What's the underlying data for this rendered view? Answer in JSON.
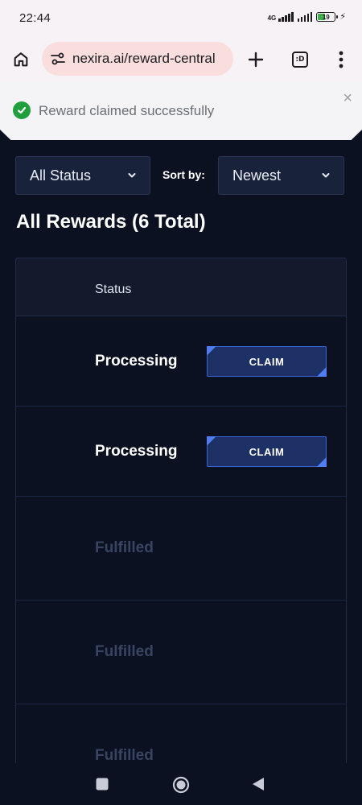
{
  "status_bar": {
    "time": "22:44",
    "network": "4G",
    "battery_level": "19"
  },
  "browser": {
    "url": "nexira.ai/reward-central",
    "tabs_label": ":D"
  },
  "toast": {
    "message": "Reward claimed successfully",
    "close_glyph": "×"
  },
  "filters": {
    "status_value": "All Status",
    "sort_label": "Sort by:",
    "sort_value": "Newest"
  },
  "list": {
    "title": "All Rewards (6 Total)",
    "column_status": "Status",
    "rows": [
      {
        "status": "Processing",
        "action": "CLAIM"
      },
      {
        "status": "Processing",
        "action": "CLAIM"
      },
      {
        "status": "Fulfilled"
      },
      {
        "status": "Fulfilled"
      },
      {
        "status": "Fulfilled"
      }
    ]
  },
  "colors": {
    "background": "#0c1121",
    "accent": "#3a63d6",
    "success": "#1fa03c",
    "muted_status": "#394463"
  },
  "icons": [
    "home-icon",
    "site-settings-icon",
    "plus-icon",
    "tab-switcher-icon",
    "more-vert-icon",
    "check-icon",
    "close-icon",
    "chevron-down-icon",
    "nav-square-icon",
    "nav-circle-icon",
    "nav-back-icon"
  ]
}
